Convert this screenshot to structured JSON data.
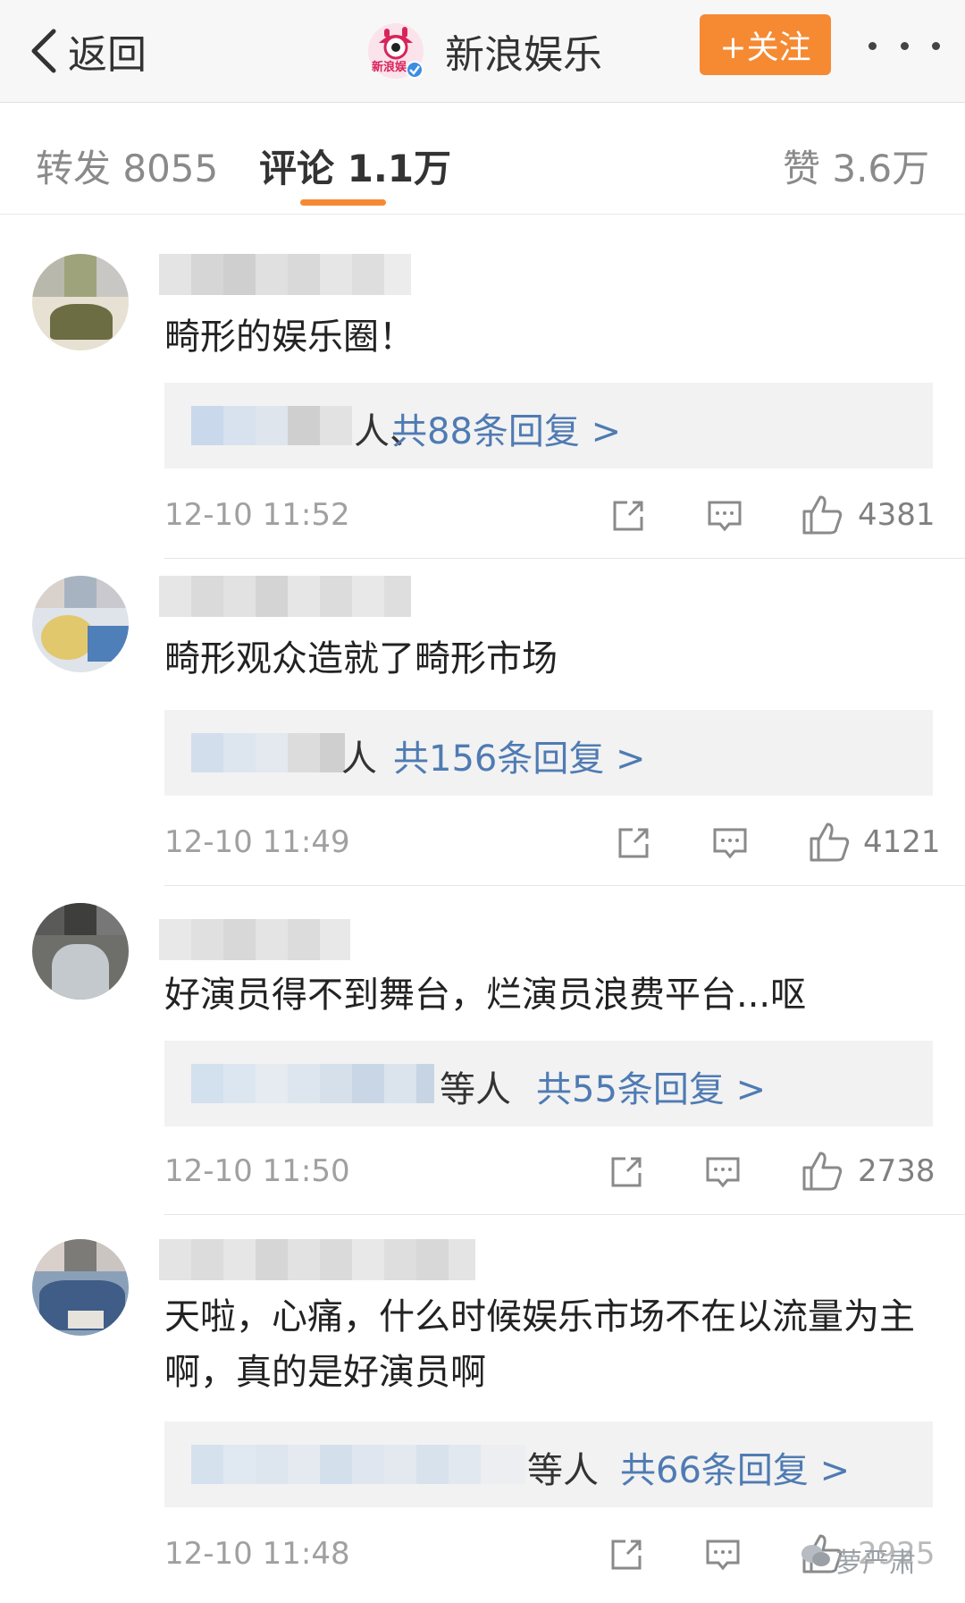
{
  "nav": {
    "back_label": "返回",
    "account_name": "新浪娱乐",
    "follow_label": "+关注",
    "logo_text": "新浪娱"
  },
  "tabs": [
    {
      "label": "转发 8055",
      "active": false
    },
    {
      "label": "评论 1.1万",
      "active": true
    },
    {
      "label": "赞 3.6万",
      "active": false
    }
  ],
  "comments": [
    {
      "text": "畸形的娱乐圈！",
      "reply_suffix": "人、",
      "reply_link": "共88条回复 >",
      "time": "12-10 11:52",
      "likes": "4381"
    },
    {
      "text": "畸形观众造就了畸形市场",
      "reply_suffix": "人",
      "reply_link": "共156条回复 >",
      "time": "12-10 11:49",
      "likes": "4121"
    },
    {
      "text": "好演员得不到舞台，烂演员浪费平台...呕",
      "reply_suffix": "等人",
      "reply_link": "共55条回复 >",
      "time": "12-10 11:50",
      "likes": "2738"
    },
    {
      "text": "天啦，心痛，什么时候娱乐市场不在以流量为主啊，真的是好演员啊",
      "reply_suffix": "等人",
      "reply_link": "共66条回复 >",
      "time": "12-10 11:48",
      "likes": "2925"
    }
  ],
  "watermark": "萝严肃",
  "colors": {
    "accent": "#f58a33",
    "link": "#4f7bb3",
    "time": "#a0a0a0"
  }
}
